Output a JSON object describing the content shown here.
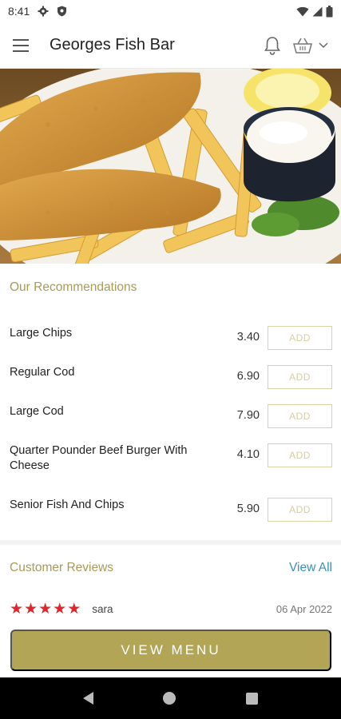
{
  "status": {
    "time": "8:41"
  },
  "app_bar": {
    "title": "Georges Fish Bar"
  },
  "recommendations": {
    "title": "Our Recommendations",
    "add_label": "ADD",
    "items": [
      {
        "name": "Large Chips",
        "price": "3.40"
      },
      {
        "name": "Regular Cod",
        "price": "6.90"
      },
      {
        "name": "Large Cod",
        "price": "7.90"
      },
      {
        "name": "Quarter Pounder Beef Burger With Cheese",
        "price": "4.10"
      },
      {
        "name": "Senior Fish And Chips",
        "price": "5.90"
      }
    ]
  },
  "reviews": {
    "title": "Customer Reviews",
    "view_all": "View All",
    "items": [
      {
        "stars": 5,
        "reviewer": "sara",
        "date": "06 Apr 2022"
      }
    ]
  },
  "view_menu_label": "VIEW MENU",
  "colors": {
    "accent": "#b3a556",
    "link": "#3b8fb8",
    "star": "#e0262b"
  }
}
